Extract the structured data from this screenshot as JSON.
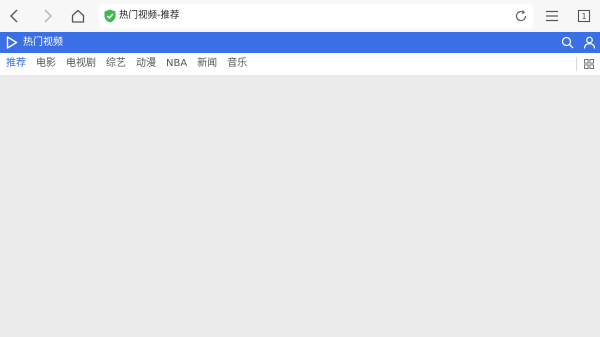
{
  "browser": {
    "icons": [
      "back-icon",
      "forward-icon",
      "home-icon",
      "shield-icon",
      "reload-icon",
      "menu-icon",
      "tab-count-icon"
    ],
    "url_text": "热门视频-推荐",
    "tab_count": "1"
  },
  "site": {
    "title": "热门视频",
    "accent_color": "#3b6fe5",
    "icons": [
      "play-icon",
      "search-icon",
      "user-icon"
    ]
  },
  "tabs": [
    {
      "label": "推荐",
      "active": true
    },
    {
      "label": "电影",
      "active": false
    },
    {
      "label": "电视剧",
      "active": false
    },
    {
      "label": "综艺",
      "active": false
    },
    {
      "label": "动漫",
      "active": false
    },
    {
      "label": "NBA",
      "active": false
    },
    {
      "label": "新闻",
      "active": false
    },
    {
      "label": "音乐",
      "active": false
    }
  ]
}
